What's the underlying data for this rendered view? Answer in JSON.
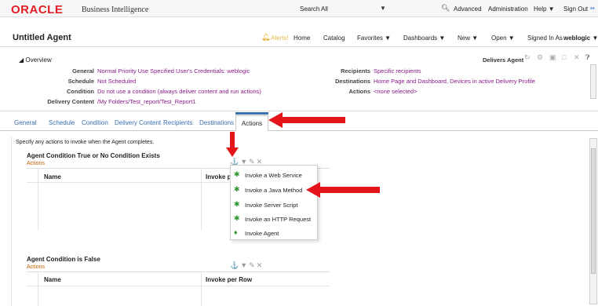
{
  "header": {
    "brand": "ORACLE",
    "product": "Business Intelligence",
    "search_label": "Search",
    "search_scope": "All",
    "nav": [
      "Advanced",
      "Administration",
      "Help ▼",
      "Sign Out"
    ]
  },
  "titlebar": {
    "title": "Untitled Agent",
    "alert_text": "Alerts!",
    "nav": [
      "Home",
      "Catalog",
      "Favorites ▼",
      "Dashboards ▼",
      "New ▼",
      "Open ▼"
    ],
    "signed_in_label": "Signed In As",
    "user": "weblogic ▼"
  },
  "overview": {
    "toggle": "Overview",
    "rows_left": [
      {
        "label": "General",
        "value": "Normal Priority  Use Specified User's Credentials: weblogic"
      },
      {
        "label": "Schedule",
        "value": "Not Scheduled"
      },
      {
        "label": "Condition",
        "value": "Do not use a condition (always deliver content and run actions)"
      },
      {
        "label": "Delivery Content",
        "value": "/My Folders/Test_report/Test_Report1"
      }
    ],
    "rows_right": [
      {
        "label": "Recipients",
        "value": "Specific recipients"
      },
      {
        "label": "Destinations",
        "value": "Home Page and Dashboard, Devices in active Delivery Profile"
      },
      {
        "label": "Actions",
        "value": "<none selected>"
      }
    ],
    "delivers_label": "Delivers Agent"
  },
  "tabs": [
    "General",
    "Schedule",
    "Condition",
    "Delivery Content",
    "Recipients",
    "Destinations",
    "Actions"
  ],
  "active_tab": "Actions",
  "actions": {
    "instruction": "Specify any actions to invoke when the Agent completes.",
    "true_section": {
      "title": "Agent Condition True or No Condition Exists",
      "subtitle": "Actions",
      "col_name": "Name",
      "col_invoke": "Invoke p"
    },
    "false_section": {
      "title": "Agent Condition is False",
      "subtitle": "Actions",
      "col_name": "Name",
      "col_invoke": "Invoke per Row"
    }
  },
  "menu": {
    "items": [
      "Invoke a Web Service",
      "Invoke a Java Method",
      "Invoke Server Script",
      "Invoke an HTTP Request",
      "Invoke Agent"
    ]
  },
  "colors": {
    "brand_red": "#e21e26",
    "link": "#3a6fb0",
    "value": "#8a1b8a",
    "arrow": "#e3151b"
  }
}
